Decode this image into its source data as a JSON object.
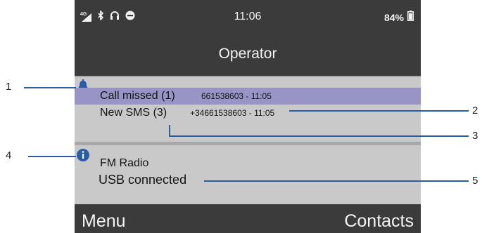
{
  "status_bar": {
    "network_label": "4G",
    "icons": [
      "signal-icon",
      "bluetooth-icon",
      "headset-icon",
      "do-not-disturb-icon",
      "battery-icon"
    ],
    "time": "11:06",
    "battery": "84%"
  },
  "title": "Operator",
  "notifications": {
    "missed_call": {
      "icon": "bell-icon",
      "label": "Call missed (1)",
      "detail": "661538603 - 11:05"
    },
    "sms": {
      "label": "New SMS (3)",
      "detail": "+34661538603 - 11:05"
    }
  },
  "info": {
    "icon": "info-icon",
    "radio_label": "FM Radio",
    "usb_label": "USB connected"
  },
  "softkeys": {
    "left": "Menu",
    "right": "Contacts"
  },
  "callouts": [
    "1",
    "2",
    "3",
    "4",
    "5"
  ],
  "colors": {
    "bar": "#3b3b3b",
    "panel": "#c9c9c9",
    "highlight": "#9895c6",
    "accent": "#2a5da8"
  }
}
